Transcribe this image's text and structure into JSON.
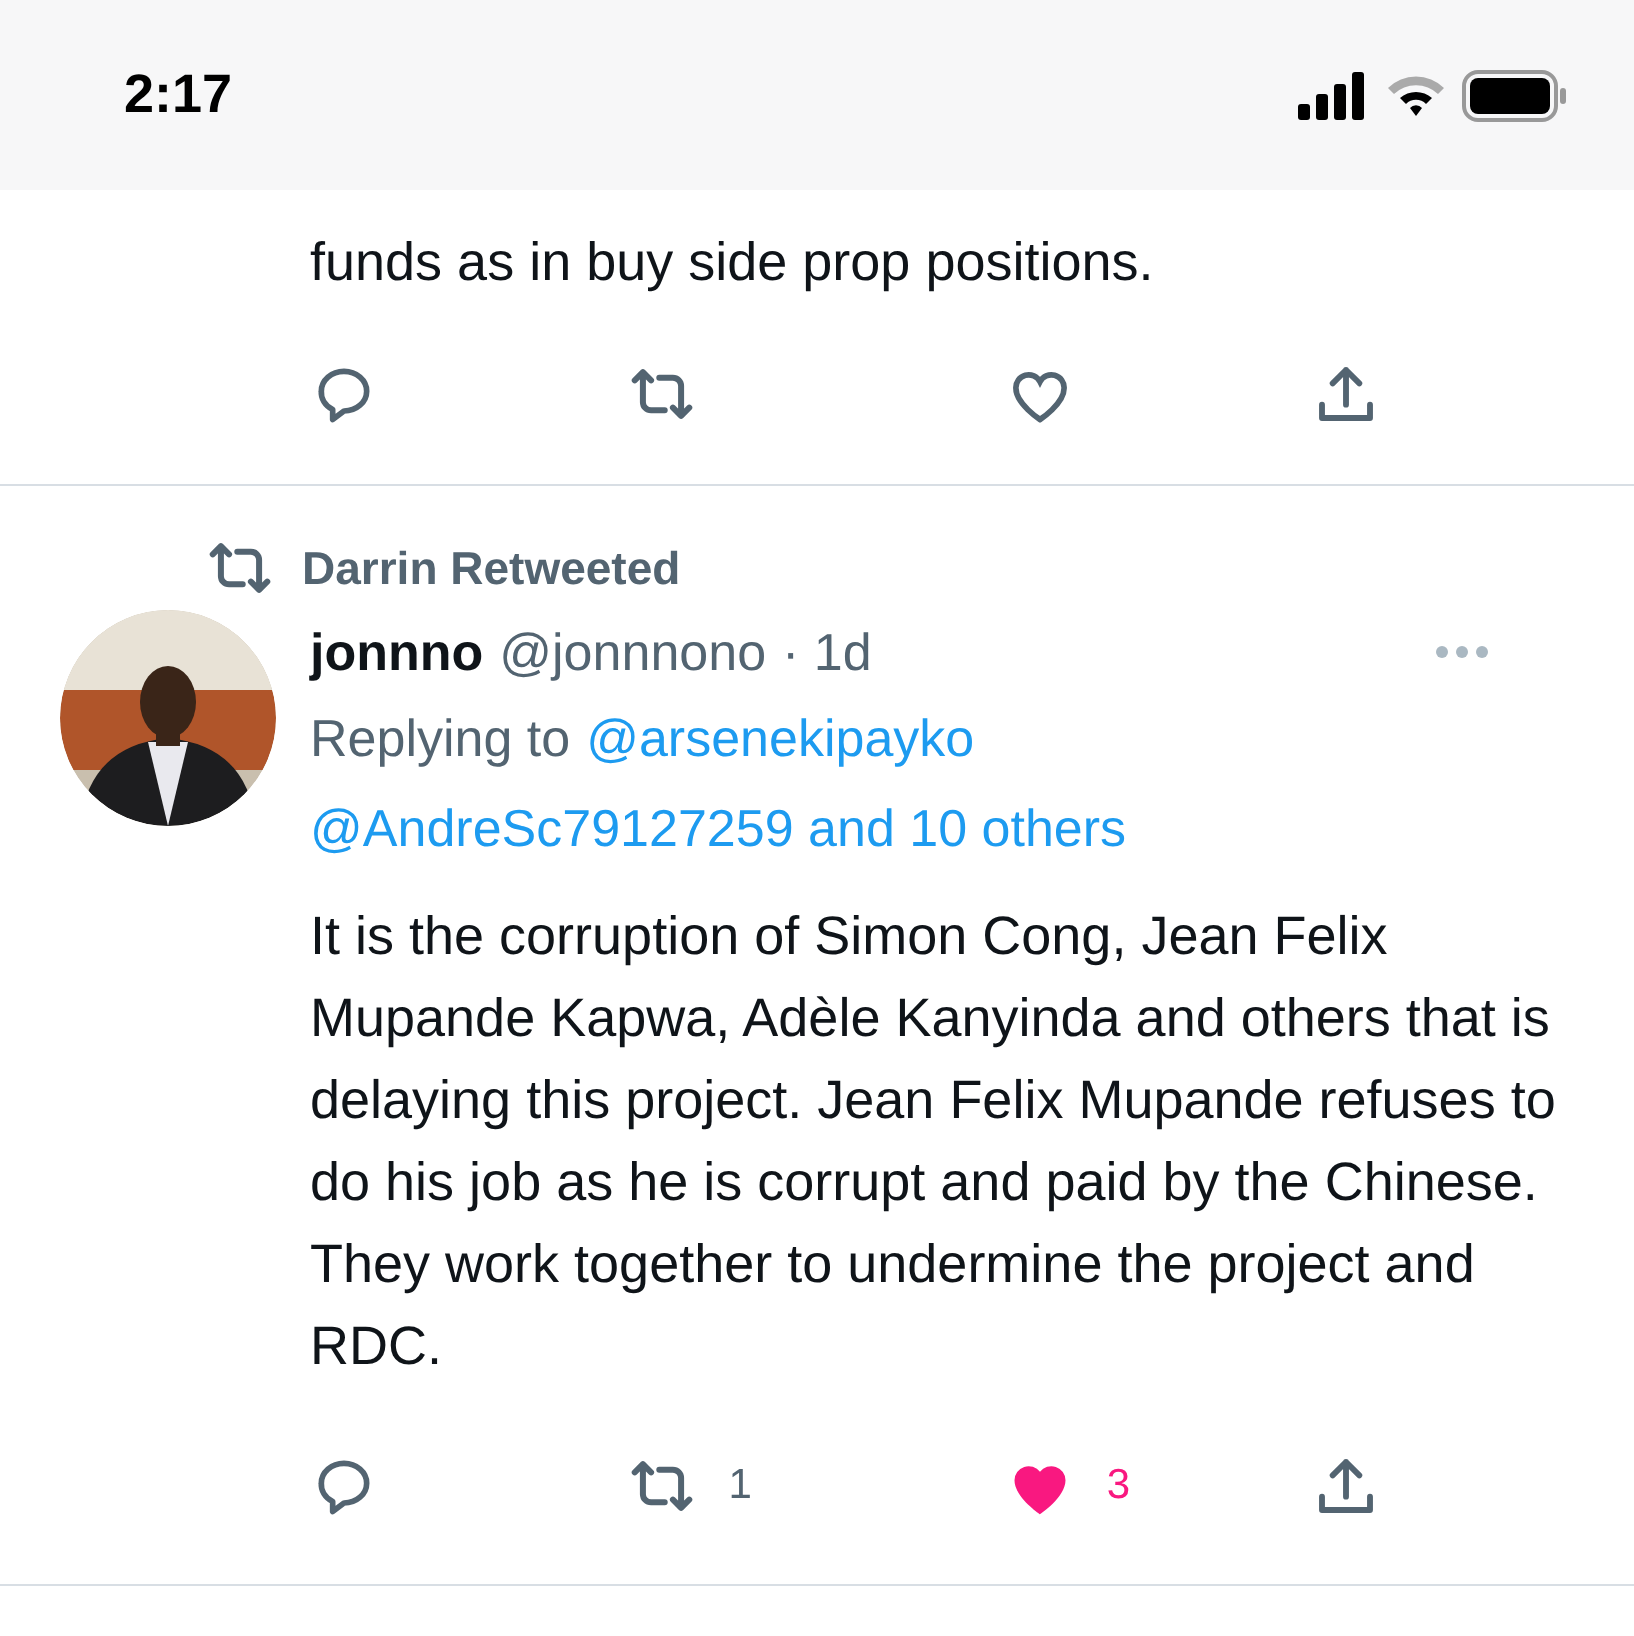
{
  "status_bar": {
    "time": "2:17"
  },
  "tweets": [
    {
      "kind": "partial",
      "text": "funds as in buy side prop positions.",
      "actions": {
        "liked": false
      }
    },
    {
      "kind": "full",
      "retweeted_by": "Darrin Retweeted",
      "name": "jonnno",
      "handle": "@jonnnono",
      "time": "· 1d",
      "replying_label": "Replying to",
      "reply_to_1": "@arsenekipayko",
      "reply_to_2": "@AndreSc79127259 and 10 others",
      "text": "It is the corruption of Simon Cong, Jean Felix Mupande Kapwa, Adèle Kanyinda and others that is delaying this project. Jean Felix Mupande refuses to do his job as he is corrupt and paid by the Chinese. They work together to undermine the project and RDC.",
      "actions": {
        "retweet_count": "1",
        "like_count": "3",
        "liked": true
      }
    }
  ]
}
